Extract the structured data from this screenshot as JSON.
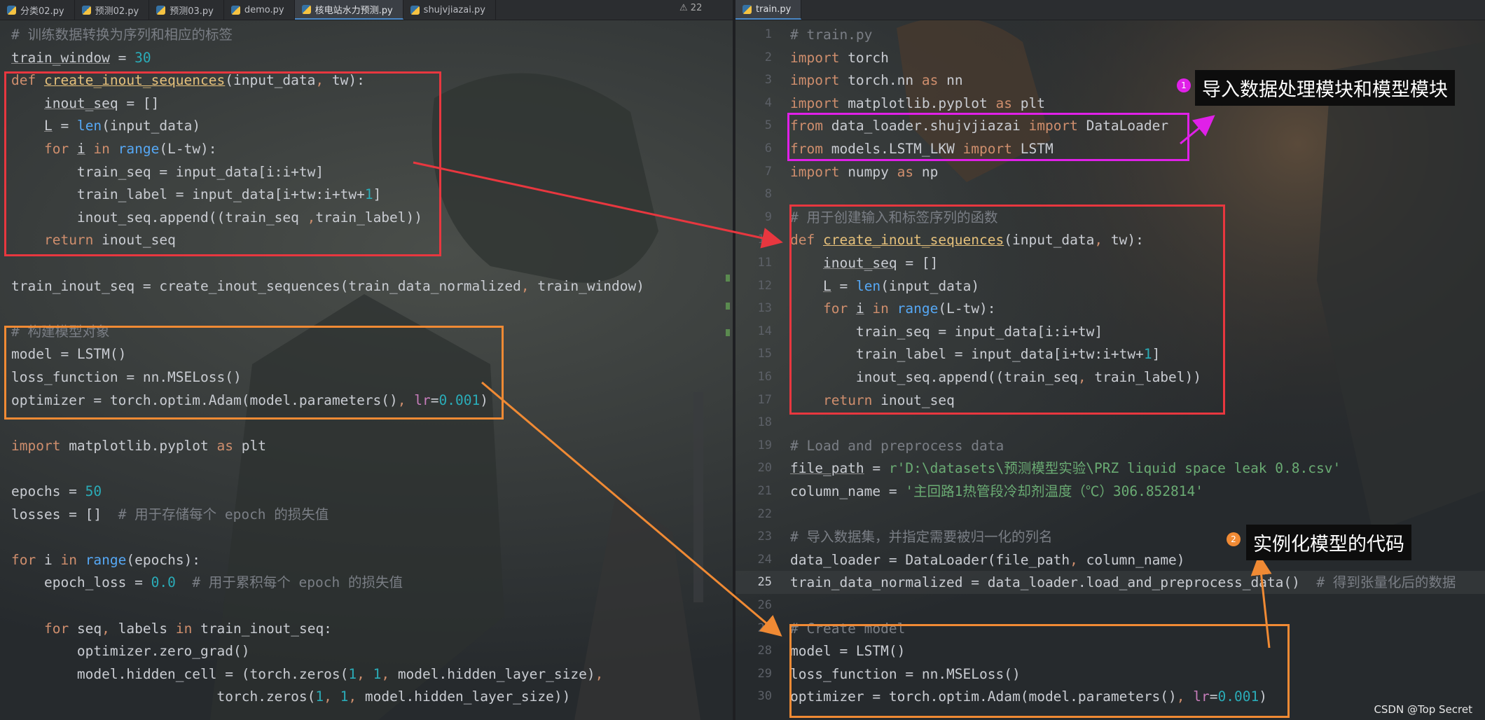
{
  "left_tabs": [
    {
      "label": "分类02.py",
      "active": false
    },
    {
      "label": "预测02.py",
      "active": false
    },
    {
      "label": "预测03.py",
      "active": false
    },
    {
      "label": "demo.py",
      "active": false
    },
    {
      "label": "核电站水力预测.py",
      "active": true
    },
    {
      "label": "shujvjiazai.py",
      "active": false
    }
  ],
  "right_tabs": [
    {
      "label": "train.py",
      "active": true
    }
  ],
  "left_editor": {
    "warning_count": "22",
    "lines": [
      [
        [
          "# 训练数据转换为序列和相应的标签",
          "cmt"
        ]
      ],
      [
        [
          "train_window",
          "ul"
        ],
        [
          " = ",
          ""
        ],
        [
          "30",
          "num"
        ]
      ],
      [
        [
          "def ",
          "kw"
        ],
        [
          "create_inout_sequences",
          "fnd"
        ],
        [
          "(input_data",
          ""
        ],
        [
          ", ",
          "kw"
        ],
        [
          "tw):",
          ""
        ]
      ],
      [
        [
          "    ",
          ""
        ],
        [
          "inout_seq",
          "ul"
        ],
        [
          " = []",
          ""
        ]
      ],
      [
        [
          "    ",
          ""
        ],
        [
          "L",
          "ul"
        ],
        [
          " = ",
          ""
        ],
        [
          "len",
          "fn"
        ],
        [
          "(input_data)",
          ""
        ]
      ],
      [
        [
          "    ",
          ""
        ],
        [
          "for ",
          "kw"
        ],
        [
          "i",
          "ul"
        ],
        [
          " in ",
          "kw"
        ],
        [
          "range",
          "fn"
        ],
        [
          "(L-tw):",
          ""
        ]
      ],
      [
        [
          "        train_seq = input_data[i:i+tw]",
          ""
        ]
      ],
      [
        [
          "        train_label = input_data[i+tw:i+tw+",
          ""
        ],
        [
          "1",
          "num"
        ],
        [
          "]",
          ""
        ]
      ],
      [
        [
          "        inout_seq.append((train_seq ",
          ""
        ],
        [
          ",",
          "kw"
        ],
        [
          "train_label))",
          ""
        ]
      ],
      [
        [
          "    ",
          ""
        ],
        [
          "return ",
          "kw"
        ],
        [
          "inout_seq",
          ""
        ]
      ],
      [],
      [
        [
          "train_inout_seq = ",
          ""
        ],
        [
          "create_inout_sequences(train_data_normalized",
          ""
        ],
        [
          ", ",
          "kw"
        ],
        [
          "train_window)",
          ""
        ]
      ],
      [],
      [
        [
          "# 构建模型对象",
          "cmt"
        ]
      ],
      [
        [
          "model = LSTM()",
          ""
        ]
      ],
      [
        [
          "loss_function = nn.MSELoss()",
          ""
        ]
      ],
      [
        [
          "optimizer = torch.optim.Adam(model.parameters()",
          ""
        ],
        [
          ", ",
          "kw"
        ],
        [
          "lr",
          "par"
        ],
        [
          "=",
          ""
        ],
        [
          "0.001",
          "num"
        ],
        [
          ")",
          ""
        ]
      ],
      [],
      [
        [
          "import",
          "kw"
        ],
        [
          " matplotlib.pyplot ",
          ""
        ],
        [
          "as ",
          "kw"
        ],
        [
          "plt",
          ""
        ]
      ],
      [],
      [
        [
          "epochs = ",
          ""
        ],
        [
          "50",
          "num"
        ]
      ],
      [
        [
          "losses = []  ",
          ""
        ],
        [
          "# 用于存储每个 epoch 的损失值",
          "cmt"
        ]
      ],
      [],
      [
        [
          "for ",
          "kw"
        ],
        [
          "i ",
          ""
        ],
        [
          "in ",
          "kw"
        ],
        [
          "range",
          "fn"
        ],
        [
          "(epochs):",
          ""
        ]
      ],
      [
        [
          "    epoch_loss = ",
          ""
        ],
        [
          "0.0",
          "num"
        ],
        [
          "  ",
          ""
        ],
        [
          "# 用于累积每个 epoch 的损失值",
          "cmt"
        ]
      ],
      [],
      [
        [
          "    ",
          ""
        ],
        [
          "for ",
          "kw"
        ],
        [
          "seq",
          ""
        ],
        [
          ", ",
          "kw"
        ],
        [
          "labels ",
          ""
        ],
        [
          "in ",
          "kw"
        ],
        [
          "train_inout_seq:",
          ""
        ]
      ],
      [
        [
          "        optimizer.zero_grad()",
          ""
        ]
      ],
      [
        [
          "        model.hidden_cell = (torch.zeros(",
          ""
        ],
        [
          "1",
          "num"
        ],
        [
          ", ",
          "kw"
        ],
        [
          "1",
          "num"
        ],
        [
          ", ",
          "kw"
        ],
        [
          "model.hidden_layer_size)",
          ""
        ],
        [
          ",",
          "kw"
        ]
      ],
      [
        [
          "                         torch.zeros(",
          ""
        ],
        [
          "1",
          "num"
        ],
        [
          ", ",
          "kw"
        ],
        [
          "1",
          "num"
        ],
        [
          ", ",
          "kw"
        ],
        [
          "model.hidden_layer_size))",
          ""
        ]
      ]
    ]
  },
  "right_editor": {
    "current_line": 25,
    "line_numbers": [
      1,
      2,
      3,
      4,
      5,
      6,
      7,
      8,
      9,
      10,
      11,
      12,
      13,
      14,
      15,
      16,
      17,
      18,
      19,
      20,
      21,
      22,
      23,
      24,
      25,
      26,
      27,
      28,
      29,
      30
    ],
    "lines": [
      [
        [
          "# train.py",
          "cmt"
        ]
      ],
      [
        [
          "import ",
          "kw"
        ],
        [
          "torch",
          ""
        ]
      ],
      [
        [
          "import ",
          "kw"
        ],
        [
          "torch.nn ",
          ""
        ],
        [
          "as ",
          "kw"
        ],
        [
          "nn",
          ""
        ]
      ],
      [
        [
          "import ",
          "kw"
        ],
        [
          "matplotlib.pyplot ",
          ""
        ],
        [
          "as ",
          "kw"
        ],
        [
          "plt",
          ""
        ]
      ],
      [
        [
          "from ",
          "kw"
        ],
        [
          "data_loader.shujvjiazai ",
          ""
        ],
        [
          "import ",
          "kw"
        ],
        [
          "DataLoader",
          ""
        ]
      ],
      [
        [
          "from ",
          "kw"
        ],
        [
          "models.LSTM_LKW ",
          ""
        ],
        [
          "import ",
          "kw"
        ],
        [
          "LSTM",
          ""
        ]
      ],
      [
        [
          "import ",
          "kw"
        ],
        [
          "numpy ",
          ""
        ],
        [
          "as ",
          "kw"
        ],
        [
          "np",
          ""
        ]
      ],
      [],
      [
        [
          "# 用于创建输入和标签序列的函数",
          "cmt"
        ]
      ],
      [
        [
          "def ",
          "kw"
        ],
        [
          "create_inout_sequences",
          "fnd"
        ],
        [
          "(input_data",
          ""
        ],
        [
          ", ",
          "kw"
        ],
        [
          "tw):",
          ""
        ]
      ],
      [
        [
          "    ",
          ""
        ],
        [
          "inout_seq",
          "ul"
        ],
        [
          " = []",
          ""
        ]
      ],
      [
        [
          "    ",
          ""
        ],
        [
          "L",
          "ul"
        ],
        [
          " = ",
          ""
        ],
        [
          "len",
          "fn"
        ],
        [
          "(input_data)",
          ""
        ]
      ],
      [
        [
          "    ",
          ""
        ],
        [
          "for ",
          "kw"
        ],
        [
          "i",
          "ul"
        ],
        [
          " in ",
          "kw"
        ],
        [
          "range",
          "fn"
        ],
        [
          "(L-tw):",
          ""
        ]
      ],
      [
        [
          "        train_seq = input_data[i:i+tw]",
          ""
        ]
      ],
      [
        [
          "        train_label = input_data[i+tw:i+tw+",
          ""
        ],
        [
          "1",
          "num"
        ],
        [
          "]",
          ""
        ]
      ],
      [
        [
          "        inout_seq.append((train_seq",
          ""
        ],
        [
          ", ",
          "kw"
        ],
        [
          "train_label))",
          ""
        ]
      ],
      [
        [
          "    ",
          ""
        ],
        [
          "return ",
          "kw"
        ],
        [
          "inout_seq",
          ""
        ]
      ],
      [],
      [
        [
          "# Load and preprocess data",
          "cmt"
        ]
      ],
      [
        [
          "file_path",
          "ul"
        ],
        [
          " = ",
          ""
        ],
        [
          "r'D:\\datasets\\预测模型实验\\PRZ liquid space leak 0.8.csv'",
          "str"
        ]
      ],
      [
        [
          "column_name = ",
          ""
        ],
        [
          "'主回路1热管段冷却剂温度（℃）306.852814'",
          "str"
        ]
      ],
      [],
      [
        [
          "# 导入数据集，并指定需要被归一化的列名",
          "cmt"
        ]
      ],
      [
        [
          "data_loader = DataLoader(file_path",
          ""
        ],
        [
          ", ",
          "kw"
        ],
        [
          "column_name)",
          ""
        ]
      ],
      [
        [
          "train_data_normalized = data_loader.load_and_preprocess_data()  ",
          ""
        ],
        [
          "# 得到张量化后的数据",
          "cmt"
        ]
      ],
      [],
      [
        [
          "# Create model",
          "cmt"
        ]
      ],
      [
        [
          "model = LSTM()",
          ""
        ]
      ],
      [
        [
          "loss_function = nn.MSELoss()",
          ""
        ]
      ],
      [
        [
          "optimizer = torch.optim.Adam(model.parameters()",
          ""
        ],
        [
          ", ",
          "kw"
        ],
        [
          "lr",
          "par"
        ],
        [
          "=",
          ""
        ],
        [
          "0.001",
          "num"
        ],
        [
          ")",
          ""
        ]
      ]
    ]
  },
  "annotations": {
    "import_note": {
      "badge": "1",
      "text": "导入数据处理模块和模型模块"
    },
    "model_note": {
      "badge": "2",
      "text": "实例化模型的代码"
    }
  },
  "watermark": "CSDN @Top Secret",
  "colors": {
    "red_box": "#e8373f",
    "orange_box": "#f08a34",
    "magenta_box": "#e020e8",
    "keyword": "#cf8e6d",
    "comment": "#7a7e85",
    "number": "#2aacb8",
    "string": "#6aab73",
    "function_def": "#e5c07b",
    "builtin": "#56a8f5"
  }
}
